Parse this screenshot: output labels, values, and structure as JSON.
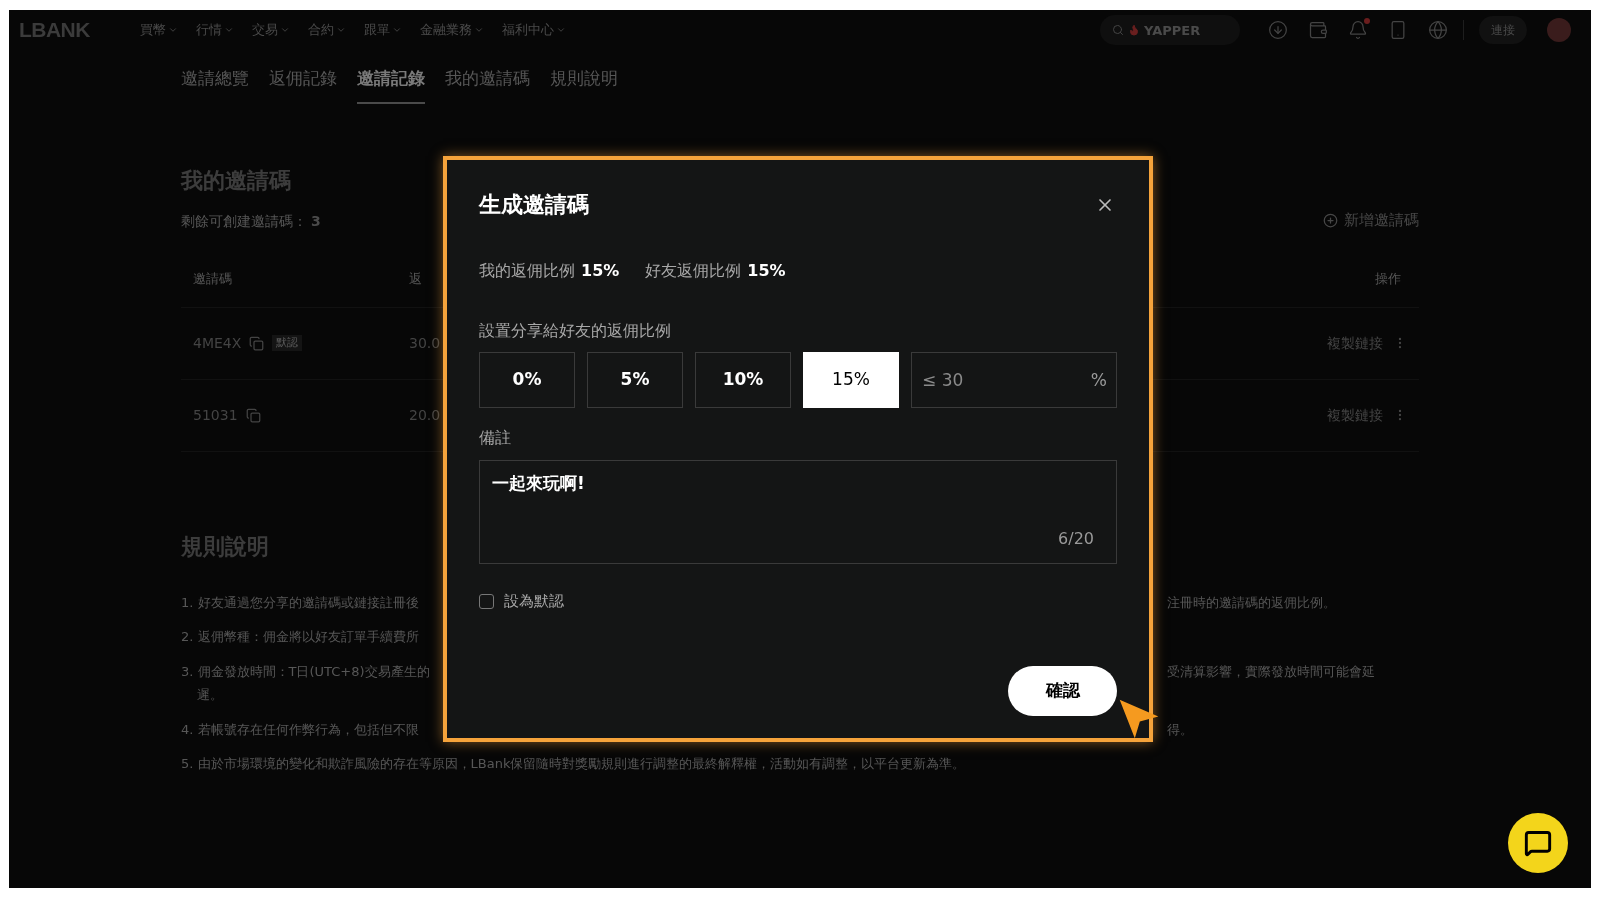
{
  "header": {
    "logo": "LBANK",
    "nav": [
      {
        "label": "買幣"
      },
      {
        "label": "行情"
      },
      {
        "label": "交易"
      },
      {
        "label": "合約"
      },
      {
        "label": "跟單"
      },
      {
        "label": "金融業務"
      },
      {
        "label": "福利中心"
      }
    ],
    "search": {
      "placeholder": "YAPPER"
    },
    "notifications_unread": true,
    "connect_button": "連接"
  },
  "tabs": [
    {
      "label": "邀請總覽",
      "selected": false
    },
    {
      "label": "返佣記錄",
      "selected": false
    },
    {
      "label": "邀請記錄",
      "selected": true
    },
    {
      "label": "我的邀請碼",
      "selected": false
    },
    {
      "label": "規則說明",
      "selected": false
    }
  ],
  "invite_codes": {
    "title": "我的邀請碼",
    "remaining_label": "剩餘可創建邀請碼：",
    "remaining_value": "3",
    "add_button": "新增邀請碼",
    "columns": [
      "邀請碼",
      "返",
      "操作"
    ],
    "rows": [
      {
        "code": "4ME4X",
        "badge": "默認",
        "column_2": "30.0",
        "action": "複製鏈接"
      },
      {
        "code": "51031",
        "column_2": "20.0",
        "action": "複製鏈接"
      }
    ]
  },
  "rules": {
    "title": "規則說明",
    "items": [
      {
        "start": "1. 好友通過您分享的邀請碼或鏈接註冊後",
        "end": "注冊時的邀請碼的返佣比例。"
      },
      {
        "start": "2. 返佣幣種：佣金將以好友訂單手續費所"
      },
      {
        "start": "3. 佣金發放時間：T日(UTC+8)交易產生的",
        "end": "受清算影響，實際發放時間可能會延",
        "wrap": "遲。"
      },
      {
        "start": "4. 若帳號存在任何作弊行為，包括但不限",
        "end": "得。"
      },
      {
        "start": "5. 由於市場環境的變化和欺詐風險的存在等原因，LBank保留隨時對獎勵規則進行調整的最終解釋權，活動如有調整，以平台更新為準。"
      }
    ]
  },
  "dialog": {
    "title": "生成邀請碼",
    "my_rate": {
      "label": "我的返佣比例",
      "value": "15%"
    },
    "friend_rate": {
      "label": "好友返佣比例",
      "value": "15%"
    },
    "share_label": "設置分享給好友的返佣比例",
    "options": [
      {
        "label": "0%",
        "selected": false
      },
      {
        "label": "5%",
        "selected": false
      },
      {
        "label": "10%",
        "selected": false
      },
      {
        "label": "15%",
        "selected": true
      }
    ],
    "custom_rate": {
      "placeholder": "≤ 30",
      "unit": "%"
    },
    "note_label": "備註",
    "note": {
      "value": "一起來玩啊!",
      "counter": "6/20"
    },
    "default_checkbox": {
      "label": "設為默認",
      "checked": false
    },
    "confirm_button": "確認"
  }
}
